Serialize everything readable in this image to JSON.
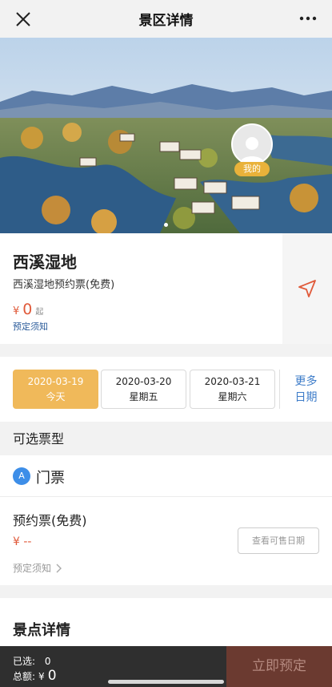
{
  "navbar": {
    "title": "景区详情"
  },
  "hero": {
    "avatar_badge": "我的"
  },
  "scenic": {
    "name": "西溪湿地",
    "subtitle": "西溪湿地预约票(免费)",
    "price_symbol": "¥",
    "price": "0",
    "price_suffix": "起",
    "notice": "预定须知"
  },
  "dates": [
    {
      "date": "2020-03-19",
      "weekday": "今天",
      "active": true
    },
    {
      "date": "2020-03-20",
      "weekday": "星期五",
      "active": false
    },
    {
      "date": "2020-03-21",
      "weekday": "星期六",
      "active": false
    }
  ],
  "more_dates": {
    "line1": "更多",
    "line2": "日期"
  },
  "ticket_section": {
    "title": "可选票型",
    "category_icon_letter": "A",
    "category": "门票",
    "ticket_name": "预约票(免费)",
    "ticket_price": "¥ --",
    "ticket_notice": "预定须知",
    "check_button": "查看可售日期"
  },
  "details": {
    "title": "景点详情"
  },
  "bottom": {
    "selected_label": "已选:",
    "selected_count": "0",
    "total_label": "总额:",
    "total_symbol": "¥",
    "total_amount": "0",
    "book_button": "立即预定"
  },
  "colors": {
    "accent": "#f0b95a",
    "price": "#e05a3a",
    "link": "#3d7cc9",
    "bottom_bar": "#2f2f2f",
    "book_button": "#6b3a30"
  }
}
